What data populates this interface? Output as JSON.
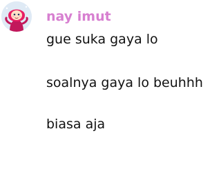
{
  "message": {
    "username": "nay imut",
    "username_color": "#d77fd0",
    "avatar_icon": "character-avatar",
    "lines": [
      "gue suka gaya lo",
      "soalnya gaya lo beuhhh",
      "biasa aja"
    ]
  }
}
